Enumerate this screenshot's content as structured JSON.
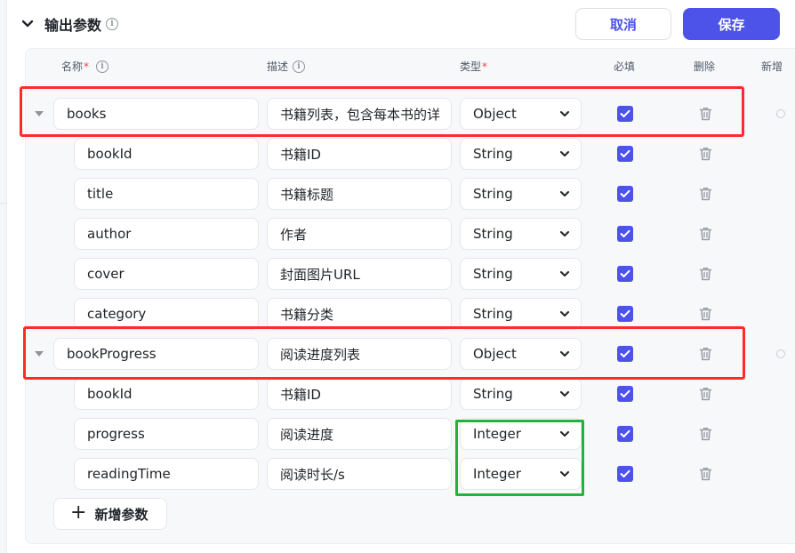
{
  "section": {
    "title": "输出参数",
    "info_glyph": "i",
    "cancel_label": "取消",
    "save_label": "保存"
  },
  "columns": {
    "name": "名称",
    "description": "描述",
    "type": "类型",
    "required": "必填",
    "delete": "删除",
    "add_child": "新增",
    "required_mark": "*"
  },
  "params": [
    {
      "name": "books",
      "description": "书籍列表，包含每本书的详",
      "type": "Object",
      "required": true,
      "level": 0,
      "expanded": true
    },
    {
      "name": "bookId",
      "description": "书籍ID",
      "type": "String",
      "required": true,
      "level": 1
    },
    {
      "name": "title",
      "description": "书籍标题",
      "type": "String",
      "required": true,
      "level": 1
    },
    {
      "name": "author",
      "description": "作者",
      "type": "String",
      "required": true,
      "level": 1
    },
    {
      "name": "cover",
      "description": "封面图片URL",
      "type": "String",
      "required": true,
      "level": 1
    },
    {
      "name": "category",
      "description": "书籍分类",
      "type": "String",
      "required": true,
      "level": 1
    },
    {
      "name": "bookProgress",
      "description": "阅读进度列表",
      "type": "Object",
      "required": true,
      "level": 0,
      "expanded": true
    },
    {
      "name": "bookId",
      "description": "书籍ID",
      "type": "String",
      "required": true,
      "level": 1
    },
    {
      "name": "progress",
      "description": "阅读进度",
      "type": "Integer",
      "required": true,
      "level": 1
    },
    {
      "name": "readingTime",
      "description": "阅读时长/s",
      "type": "Integer",
      "required": true,
      "level": 1
    }
  ],
  "add_param_label": "新增参数",
  "add_param_icon": "+",
  "colors": {
    "accent": "#4d53e8",
    "highlight_red": "#ff2b2b",
    "highlight_green": "#22b33a"
  }
}
